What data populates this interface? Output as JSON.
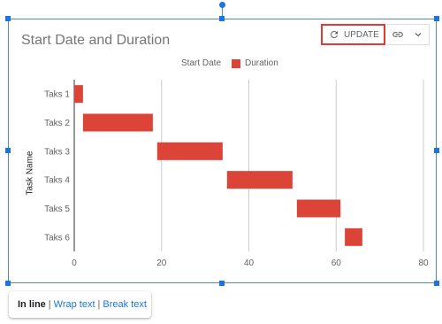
{
  "chart_toolbar": {
    "update_label": "UPDATE",
    "update_icon": "refresh-icon",
    "link_icon": "link-icon",
    "menu_icon": "chevron-down-icon"
  },
  "wrap_options": {
    "inline": "In line",
    "wrap": "Wrap text",
    "break": "Break text",
    "separator": "|"
  },
  "colors": {
    "accent": "#1a73e8",
    "bar": "#db4437",
    "update_border": "#e53935"
  },
  "chart_data": {
    "type": "bar",
    "orientation": "horizontal-stacked",
    "title": "Start Date and Duration",
    "ylabel": "Task Name",
    "xlabel": "",
    "categories": [
      "Taks 1",
      "Taks 2",
      "Taks 3",
      "Taks 4",
      "Taks 5",
      "Taks 6"
    ],
    "series": [
      {
        "name": "Start Date",
        "values": [
          0,
          2,
          19,
          35,
          51,
          62
        ],
        "visible": false
      },
      {
        "name": "Duration",
        "values": [
          2,
          16,
          15,
          15,
          10,
          4
        ],
        "color": "#db4437"
      }
    ],
    "xlim": [
      0,
      80
    ],
    "xticks": [
      0,
      20,
      40,
      60,
      80
    ],
    "grid": true,
    "legend": "top"
  }
}
